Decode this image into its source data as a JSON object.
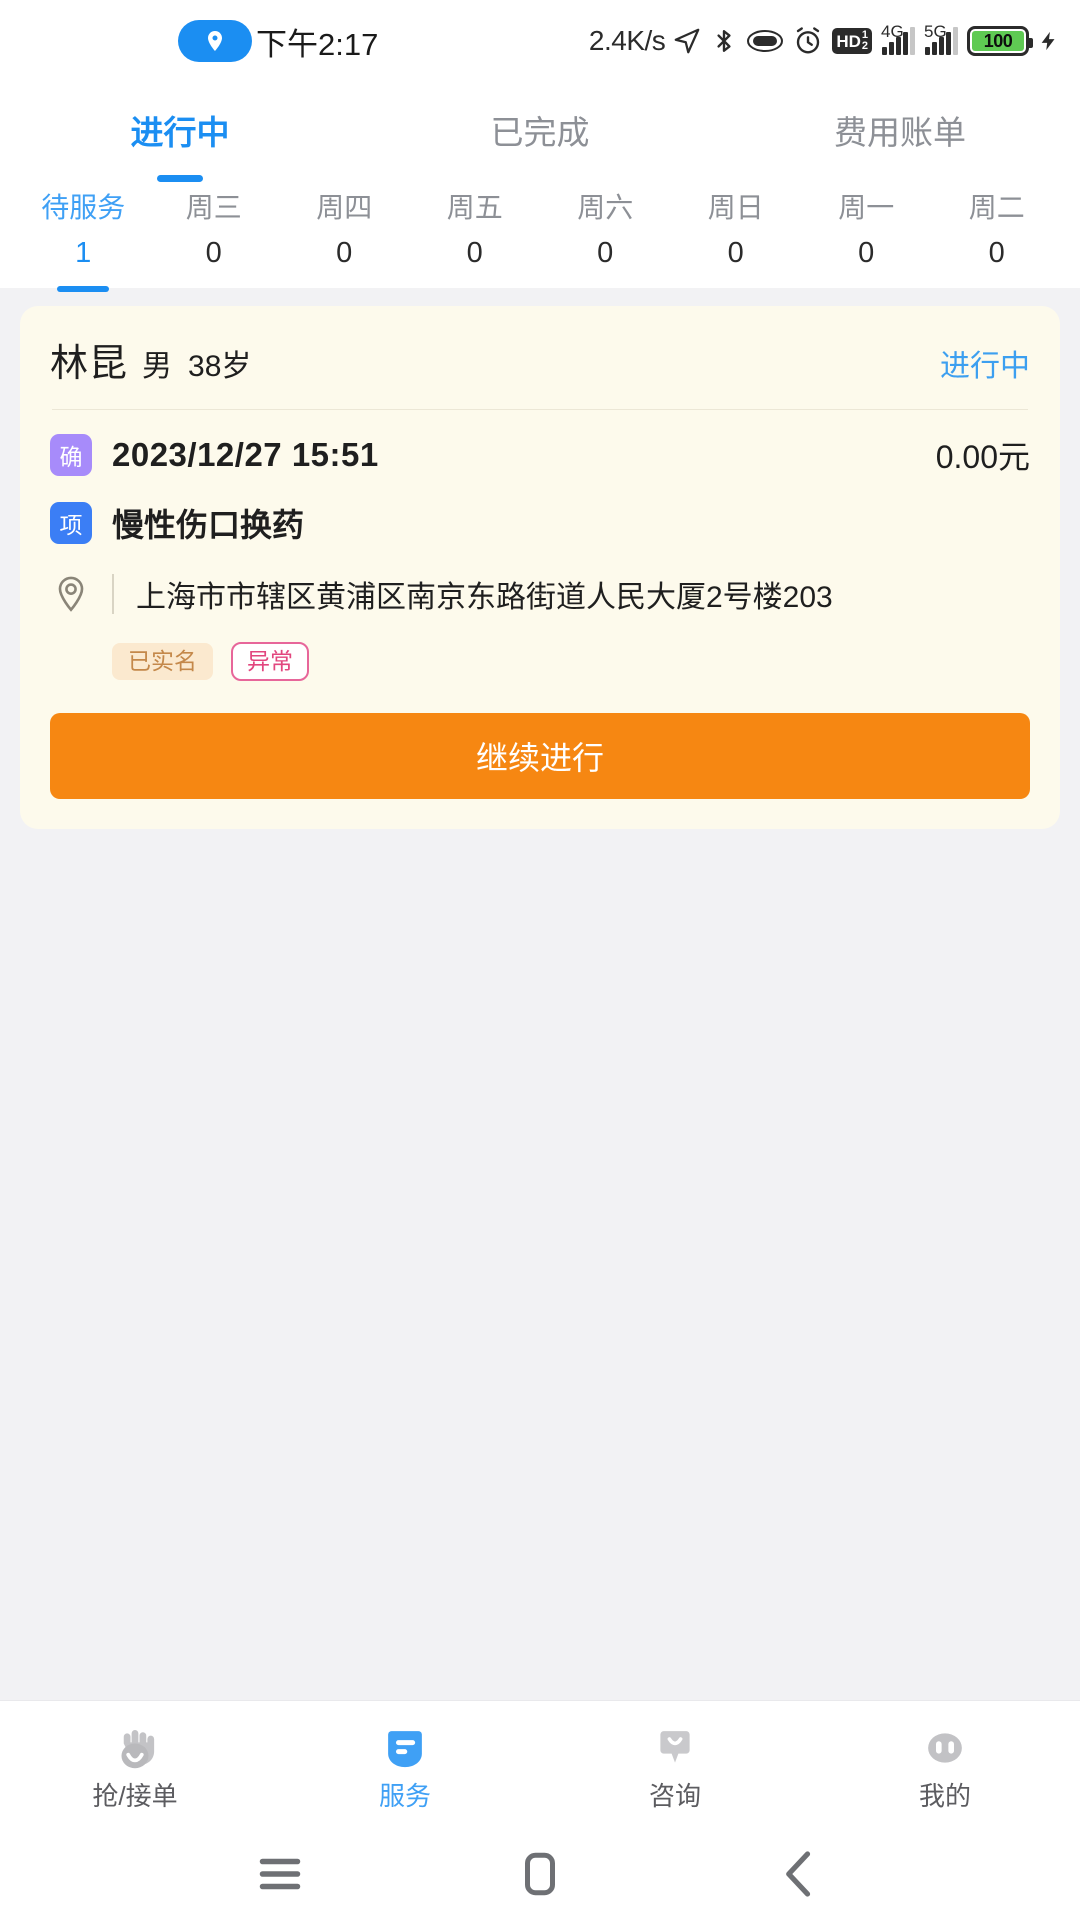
{
  "statusbar": {
    "location_icon": "location-pin-icon",
    "time": "下午2:17",
    "network_speed": "2.4K/s",
    "icons": [
      "navigation-arrow-icon",
      "bluetooth-icon",
      "nfc-ring-icon",
      "alarm-clock-icon"
    ],
    "hd_label": "HD",
    "hd_sub": "1",
    "hd_sub2": "2",
    "sim1_label": "4G",
    "sim2_label": "5G",
    "battery_level": "100",
    "charging": true
  },
  "header": {
    "tabs": [
      {
        "label": "进行中",
        "active": true
      },
      {
        "label": "已完成",
        "active": false
      },
      {
        "label": "费用账单",
        "active": false
      }
    ],
    "days": [
      {
        "label": "待服务",
        "count": "1",
        "active": true
      },
      {
        "label": "周三",
        "count": "0",
        "active": false
      },
      {
        "label": "周四",
        "count": "0",
        "active": false
      },
      {
        "label": "周五",
        "count": "0",
        "active": false
      },
      {
        "label": "周六",
        "count": "0",
        "active": false
      },
      {
        "label": "周日",
        "count": "0",
        "active": false
      },
      {
        "label": "周一",
        "count": "0",
        "active": false
      },
      {
        "label": "周二",
        "count": "0",
        "active": false
      }
    ]
  },
  "order_card": {
    "patient_name": "林昆",
    "patient_sex": "男",
    "patient_age": "38岁",
    "status": "进行中",
    "confirm_badge": "确",
    "datetime": "2023/12/27 15:51",
    "price": "0.00元",
    "item_badge": "项",
    "item_name": "慢性伤口换药",
    "address": "上海市市辖区黄浦区南京东路街道人民大厦2号楼203",
    "chips": [
      {
        "label": "已实名",
        "style": "verified"
      },
      {
        "label": "异常",
        "style": "abnormal"
      }
    ],
    "cta_label": "继续进行"
  },
  "bottomnav": {
    "items": [
      {
        "label": "抢/接单",
        "icon": "hand-grab-icon",
        "active": false
      },
      {
        "label": "服务",
        "icon": "service-card-icon",
        "active": true
      },
      {
        "label": "咨询",
        "icon": "chat-bubble-icon",
        "active": false
      },
      {
        "label": "我的",
        "icon": "profile-face-icon",
        "active": false
      }
    ]
  },
  "androidnav": {
    "recents": "menu-icon",
    "home": "home-square-icon",
    "back": "back-chevron-icon"
  },
  "colors": {
    "accent_blue": "#1b8ef2",
    "cta_orange": "#f68712",
    "card_bg": "#fdfaec",
    "page_bg": "#f2f2f4",
    "badge_purple": "#a78bfa",
    "badge_blue": "#3b7ef5",
    "chip_verified_text": "#c4884a",
    "chip_abnormal_text": "#e2467e",
    "battery_green": "#5fca53"
  }
}
